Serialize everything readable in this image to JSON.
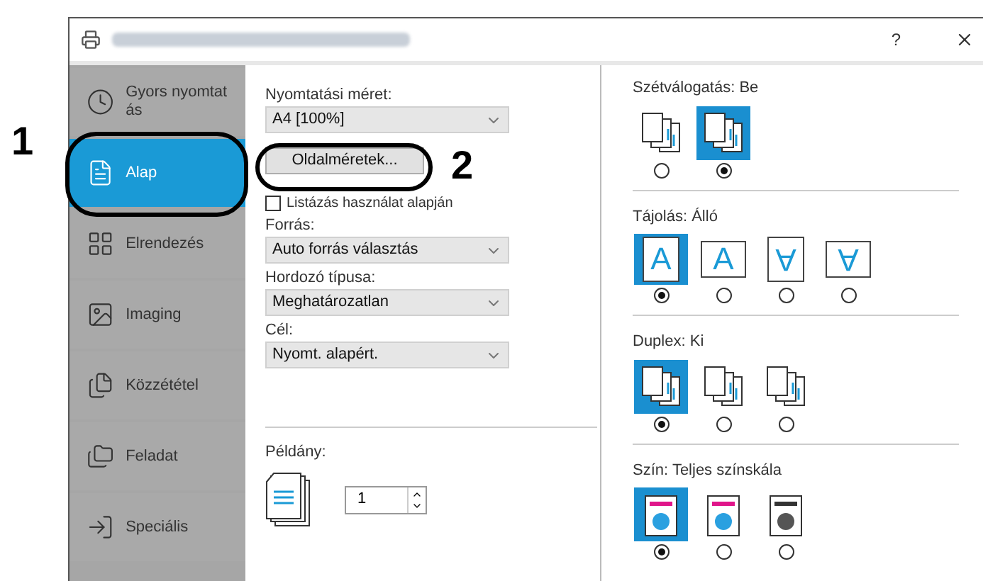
{
  "title_bar": {
    "help": "?"
  },
  "callouts": [
    {
      "label": "1"
    },
    {
      "label": "2"
    }
  ],
  "sidebar": {
    "items": [
      {
        "label": "Gyors nyomtatás",
        "kind": "clock",
        "selected": false
      },
      {
        "label": "Alap",
        "kind": "page",
        "selected": true
      },
      {
        "label": "Elrendezés",
        "kind": "grid",
        "selected": false
      },
      {
        "label": "Imaging",
        "kind": "image",
        "selected": false
      },
      {
        "label": "Közzététel",
        "kind": "document",
        "selected": false
      },
      {
        "label": "Feladat",
        "kind": "folders",
        "selected": false
      },
      {
        "label": "Speciális",
        "kind": "exit",
        "selected": false
      }
    ]
  },
  "basic": {
    "print_size": {
      "label": "Nyomtatási méret:",
      "value": "A4  [100%]"
    },
    "page_sizes_button": "Oldalméretek...",
    "usage_checkbox": {
      "label": "Listázás használat alapján",
      "checked": false
    },
    "source": {
      "label": "Forrás:",
      "value": "Auto forrás választás"
    },
    "media_type": {
      "label": "Hordozó típusa:",
      "value": "Meghatározatlan"
    },
    "destination": {
      "label": "Cél:",
      "value": "Nyomt. alapért."
    },
    "copies": {
      "label": "Példány:",
      "value": "1"
    }
  },
  "groups": [
    {
      "kind": "collation",
      "label": "Szétválogatás:",
      "value": "Be",
      "options": [
        {
          "selected": false
        },
        {
          "selected": true
        }
      ]
    },
    {
      "kind": "orientation",
      "label": "Tájolás:",
      "value": "Álló",
      "options": [
        {
          "glyph": "A",
          "landscape": false,
          "rotated": false,
          "selected": true
        },
        {
          "glyph": "A",
          "landscape": true,
          "rotated": false,
          "selected": false
        },
        {
          "glyph": "A",
          "landscape": false,
          "rotated": true,
          "selected": false
        },
        {
          "glyph": "A",
          "landscape": true,
          "rotated": true,
          "selected": false
        }
      ]
    },
    {
      "kind": "duplex",
      "label": "Duplex:",
      "value": "Ki",
      "options": [
        {
          "selected": true
        },
        {
          "selected": false
        },
        {
          "selected": false
        }
      ]
    },
    {
      "kind": "color",
      "label": "Szín:",
      "value": "Teljes színskála",
      "options": [
        {
          "selected": true
        },
        {
          "selected": false
        },
        {
          "selected": false
        }
      ]
    }
  ]
}
